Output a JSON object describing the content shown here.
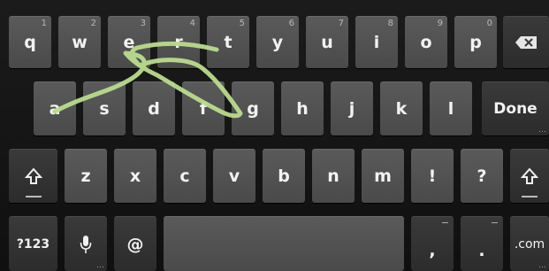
{
  "rows": {
    "row1": [
      {
        "name": "key-q",
        "label": "q",
        "hint": "1"
      },
      {
        "name": "key-w",
        "label": "w",
        "hint": "2"
      },
      {
        "name": "key-e",
        "label": "e",
        "hint": "3"
      },
      {
        "name": "key-r",
        "label": "r",
        "hint": "4"
      },
      {
        "name": "key-t",
        "label": "t",
        "hint": "5"
      },
      {
        "name": "key-y",
        "label": "y",
        "hint": "6"
      },
      {
        "name": "key-u",
        "label": "u",
        "hint": "7"
      },
      {
        "name": "key-i",
        "label": "i",
        "hint": "8"
      },
      {
        "name": "key-o",
        "label": "o",
        "hint": "9"
      },
      {
        "name": "key-p",
        "label": "p",
        "hint": "0"
      }
    ],
    "row2": [
      {
        "name": "key-a",
        "label": "a"
      },
      {
        "name": "key-s",
        "label": "s"
      },
      {
        "name": "key-d",
        "label": "d"
      },
      {
        "name": "key-f",
        "label": "f"
      },
      {
        "name": "key-g",
        "label": "g"
      },
      {
        "name": "key-h",
        "label": "h"
      },
      {
        "name": "key-j",
        "label": "j"
      },
      {
        "name": "key-k",
        "label": "k"
      },
      {
        "name": "key-l",
        "label": "l"
      }
    ],
    "row3": [
      {
        "name": "key-z",
        "label": "z"
      },
      {
        "name": "key-x",
        "label": "x"
      },
      {
        "name": "key-c",
        "label": "c"
      },
      {
        "name": "key-v",
        "label": "v"
      },
      {
        "name": "key-b",
        "label": "b"
      },
      {
        "name": "key-n",
        "label": "n"
      },
      {
        "name": "key-m",
        "label": "m"
      },
      {
        "name": "key-exclamation",
        "label": "!"
      },
      {
        "name": "key-question",
        "label": "?"
      }
    ]
  },
  "special": {
    "done_label": "Done",
    "symbols_label": "?123",
    "at_label": "@",
    "comma_label": ",",
    "period_label": ".",
    "com_label": ".com"
  },
  "icons": {
    "backspace": "backspace-icon",
    "shift": "shift-arrow-icon",
    "microphone": "microphone-icon"
  },
  "colors": {
    "key_face": "#525252",
    "key_dark": "#333333",
    "background": "#141414",
    "key_text": "#f2f2f2",
    "gesture_trail": "#b9dc8c"
  }
}
